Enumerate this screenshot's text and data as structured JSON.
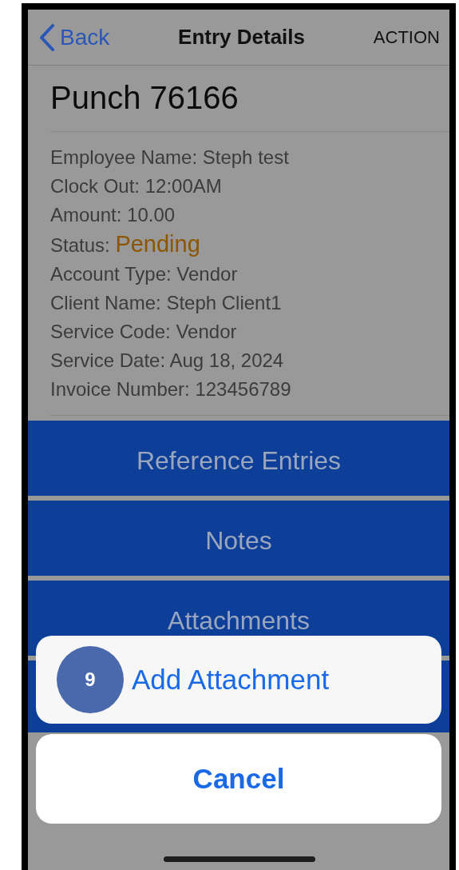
{
  "nav": {
    "back": "Back",
    "title": "Entry Details",
    "action": "ACTION"
  },
  "entry_title": "Punch 76166",
  "details": [
    {
      "label": "Employee Name:",
      "value": "Steph test",
      "kind": "plain"
    },
    {
      "label": "Clock Out:",
      "value": "12:00AM",
      "kind": "plain"
    },
    {
      "label": "Amount:",
      "value": "10.00",
      "kind": "plain"
    },
    {
      "label": "Status:",
      "value": "Pending",
      "kind": "status"
    },
    {
      "label": "Account Type:",
      "value": "Vendor",
      "kind": "plain"
    },
    {
      "label": "Client Name:",
      "value": "Steph Client1",
      "kind": "plain"
    },
    {
      "label": "Service Code:",
      "value": "Vendor",
      "kind": "plain"
    },
    {
      "label": "Service Date:",
      "value": "Aug 18, 2024",
      "kind": "plain"
    },
    {
      "label": "Invoice Number:",
      "value": "123456789",
      "kind": "plain"
    }
  ],
  "menu_buttons": [
    {
      "kind": "button",
      "label": "Reference Entries"
    },
    {
      "kind": "button",
      "label": "Notes"
    },
    {
      "kind": "button",
      "label": "Attachments"
    },
    {
      "kind": "blank"
    }
  ],
  "action_sheet": {
    "options": [
      {
        "label": "Add Attachment",
        "step": "9"
      }
    ],
    "cancel": "Cancel"
  }
}
